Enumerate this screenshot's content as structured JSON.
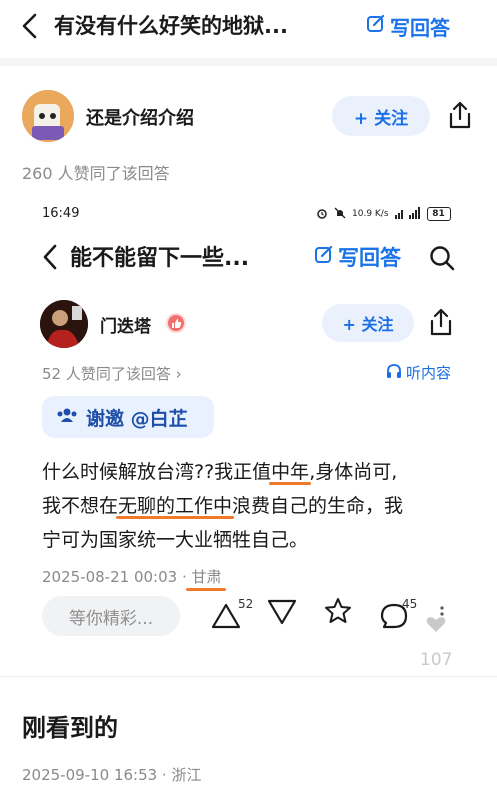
{
  "header": {
    "title": "有没有什么好笑的地狱...",
    "write_label": "写回答"
  },
  "answer_author": {
    "name": "还是介绍介绍",
    "follow_label": "+ 关注",
    "likes_text": "260 人赞同了该回答"
  },
  "embedded": {
    "status": {
      "time": "16:49",
      "net_speed": "10.9 K/s",
      "battery": "81"
    },
    "title": "能不能留下一些...",
    "write_label": "写回答",
    "author": {
      "name": "门迭塔",
      "follow_label": "+ 关注",
      "likes_text": "52 人赞同了该回答 ›",
      "listen_label": "听内容"
    },
    "invite_text": "谢邀 @白芷",
    "answer": {
      "p1": "什么时候解放台湾??我正值",
      "hl1": "中年",
      "p2": ",身体尚可,",
      "p3": "我不想在",
      "hl2": "无聊的工作中",
      "p4": "浪费自己的生命，我",
      "p5": "宁可为国家统一大业牺牲自己。"
    },
    "meta": {
      "datetime": "2025-08-21 00:03",
      "separator": "·",
      "location": "甘肃"
    },
    "comment_placeholder": "等你精彩...",
    "upvotes": "52",
    "comments": "45",
    "faded_count": "107"
  },
  "section_title": "刚看到的",
  "footer_meta": "2025-09-10 16:53 · 浙江",
  "colors": {
    "accent_blue": "#1a73e8",
    "highlight_orange": "#f07a2a"
  }
}
